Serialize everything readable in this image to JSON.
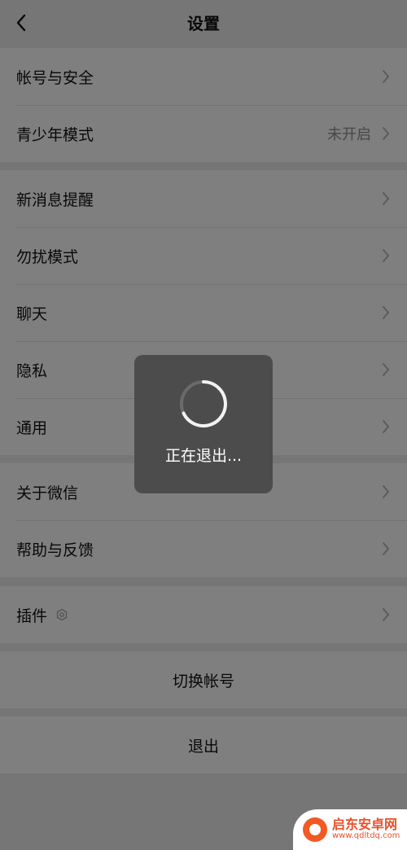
{
  "header": {
    "title": "设置",
    "back_icon": "chevron-left-icon"
  },
  "groups": [
    {
      "items": [
        {
          "label": "帐号与安全",
          "value": ""
        },
        {
          "label": "青少年模式",
          "value": "未开启"
        }
      ]
    },
    {
      "items": [
        {
          "label": "新消息提醒",
          "value": ""
        },
        {
          "label": "勿扰模式",
          "value": ""
        },
        {
          "label": "聊天",
          "value": ""
        },
        {
          "label": "隐私",
          "value": ""
        },
        {
          "label": "通用",
          "value": ""
        }
      ]
    },
    {
      "items": [
        {
          "label": "关于微信",
          "value": ""
        },
        {
          "label": "帮助与反馈",
          "value": ""
        }
      ]
    },
    {
      "items": [
        {
          "label": "插件",
          "value": "",
          "icon": "plugin-icon"
        }
      ]
    }
  ],
  "actions": {
    "switch_account": "切换帐号",
    "logout": "退出"
  },
  "toast": {
    "text": "正在退出..."
  },
  "watermark": {
    "title": "启东安卓网",
    "url": "www.qdltdq.com"
  },
  "colors": {
    "background": "#ededed",
    "cell": "#ffffff",
    "toast": "#4c4c4c",
    "watermark_accent": "#e8502a"
  }
}
